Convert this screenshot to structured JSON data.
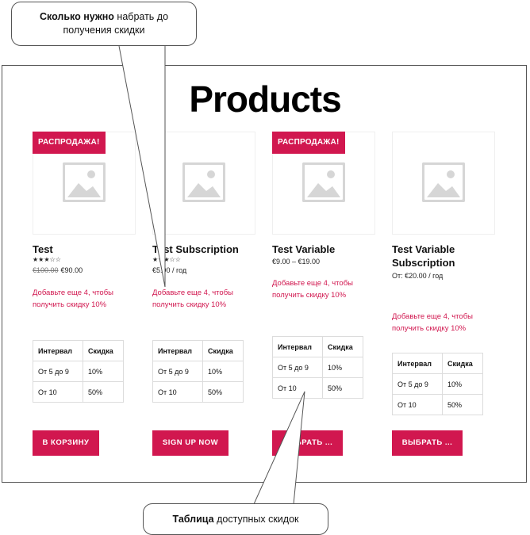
{
  "page": {
    "title": "Products"
  },
  "products": [
    {
      "sale_badge": "РАСПРОДАЖА!",
      "title": "Test",
      "rating_stars": "★★★☆☆",
      "price_old": "€100.00",
      "price": "€90.00",
      "promo_line1": "Добавьте еще 4, чтобы",
      "promo_line2": "получить скидку 10%",
      "table": {
        "col1": "Интервал",
        "col2": "Скидка",
        "rows": [
          [
            "От 5 до 9",
            "10%"
          ],
          [
            "От 10",
            "50%"
          ]
        ]
      },
      "button": "В КОРЗИНУ"
    },
    {
      "title": "Test Subscription",
      "rating_stars": "★★★☆☆",
      "price": "€5.00 / год",
      "promo_line1": "Добавьте еще 4, чтобы",
      "promo_line2": "получить скидку 10%",
      "table": {
        "col1": "Интервал",
        "col2": "Скидка",
        "rows": [
          [
            "От 5 до 9",
            "10%"
          ],
          [
            "От 10",
            "50%"
          ]
        ]
      },
      "button": "SIGN UP NOW"
    },
    {
      "sale_badge": "РАСПРОДАЖА!",
      "title": "Test Variable",
      "price": "€9.00 – €19.00",
      "promo_line1": "Добавьте еще 4, чтобы",
      "promo_line2": "получить скидку 10%",
      "table": {
        "col1": "Интервал",
        "col2": "Скидка",
        "rows": [
          [
            "От 5 до 9",
            "10%"
          ],
          [
            "От 10",
            "50%"
          ]
        ]
      },
      "button": "ВЫБРАТЬ ..."
    },
    {
      "title_line1": "Test Variable",
      "title_line2": "Subscription",
      "price": "От: €20.00 / год",
      "promo_line1": "Добавьте еще 4, чтобы",
      "promo_line2": "получить скидку 10%",
      "table": {
        "col1": "Интервал",
        "col2": "Скидка",
        "rows": [
          [
            "От 5 до 9",
            "10%"
          ],
          [
            "От 10",
            "50%"
          ]
        ]
      },
      "button": "ВЫБРАТЬ ..."
    }
  ],
  "callouts": {
    "top_bold": "Сколько нужно",
    "top_rest": " набрать до",
    "top_line2": "получения скидки",
    "bottom_bold": "Таблица",
    "bottom_rest": " доступных скидок"
  },
  "colors": {
    "accent": "#d1174f",
    "placeholder": "#d6d6d6"
  },
  "icons": {
    "product_image": "image-placeholder-icon",
    "rating": "star-rating-icon"
  }
}
